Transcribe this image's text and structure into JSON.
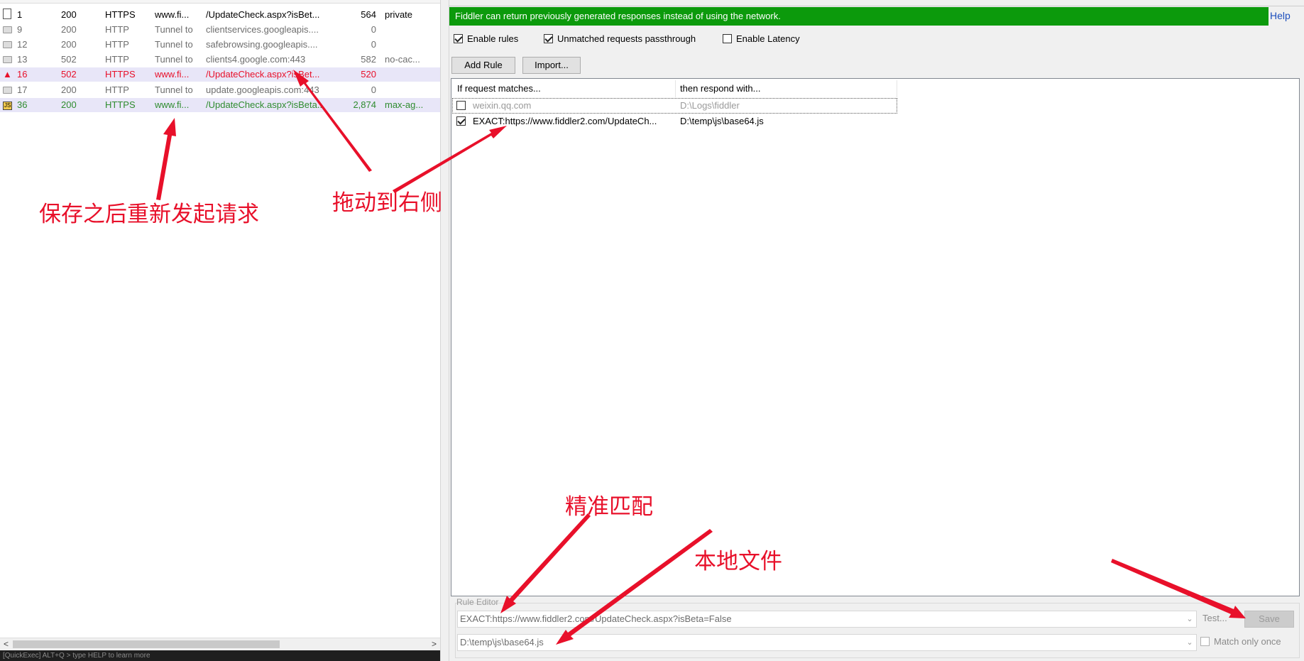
{
  "sessions": [
    {
      "icon": "page",
      "num": "1",
      "result": "200",
      "protocol": "HTTPS",
      "host": "www.fi...",
      "url": "/UpdateCheck.aspx?isBet...",
      "body": "564",
      "caching": "private",
      "color": "black"
    },
    {
      "icon": "lock",
      "num": "9",
      "result": "200",
      "protocol": "HTTP",
      "host": "Tunnel to",
      "url": "clientservices.googleapis....",
      "body": "0",
      "caching": "",
      "color": "gray"
    },
    {
      "icon": "lock",
      "num": "12",
      "result": "200",
      "protocol": "HTTP",
      "host": "Tunnel to",
      "url": "safebrowsing.googleapis....",
      "body": "0",
      "caching": "",
      "color": "gray"
    },
    {
      "icon": "lock",
      "num": "13",
      "result": "502",
      "protocol": "HTTP",
      "host": "Tunnel to",
      "url": "clients4.google.com:443",
      "body": "582",
      "caching": "no-cac...",
      "color": "gray"
    },
    {
      "icon": "warning",
      "num": "16",
      "result": "502",
      "protocol": "HTTPS",
      "host": "www.fi...",
      "url": "/UpdateCheck.aspx?isBet...",
      "body": "520",
      "caching": "",
      "color": "red"
    },
    {
      "icon": "lock",
      "num": "17",
      "result": "200",
      "protocol": "HTTP",
      "host": "Tunnel to",
      "url": "update.googleapis.com:443",
      "body": "0",
      "caching": "",
      "color": "gray"
    },
    {
      "icon": "js",
      "num": "36",
      "result": "200",
      "protocol": "HTTPS",
      "host": "www.fi...",
      "url": "/UpdateCheck.aspx?isBeta...",
      "body": "2,874",
      "caching": "max-ag...",
      "color": "green"
    }
  ],
  "scrollbar": {
    "left": "<",
    "right": ">"
  },
  "quickexec": "[QuickExec] ALT+Q > type HELP to learn more",
  "banner": "Fiddler can return previously generated responses instead of using the network.",
  "help": "Help",
  "options": {
    "enable_rules": "Enable rules",
    "unmatched": "Unmatched requests passthrough",
    "latency": "Enable Latency"
  },
  "buttons": {
    "add_rule": "Add Rule",
    "import": "Import..."
  },
  "columns": {
    "match": "If request matches...",
    "respond": "then respond with..."
  },
  "rules": [
    {
      "checked": false,
      "match": "weixin.qq.com",
      "respond": "D:\\Logs\\fiddler"
    },
    {
      "checked": true,
      "match": "EXACT:https://www.fiddler2.com/UpdateCh...",
      "respond": "D:\\temp\\js\\base64.js"
    }
  ],
  "editor": {
    "label": "Rule Editor",
    "match_value": "EXACT:https://www.fiddler2.com/UpdateCheck.aspx?isBeta=False",
    "respond_value": "D:\\temp\\js\\base64.js",
    "test": "Test...",
    "save": "Save",
    "match_once": "Match only once"
  },
  "annotations": {
    "resend": "保存之后重新发起请求",
    "drag": "拖动到右侧",
    "exact": "精准匹配",
    "local_file": "本地文件"
  },
  "colors": {
    "banner": "#0c9a0c",
    "annotation": "#e8102a",
    "selected_row": "#e8e6f8"
  }
}
